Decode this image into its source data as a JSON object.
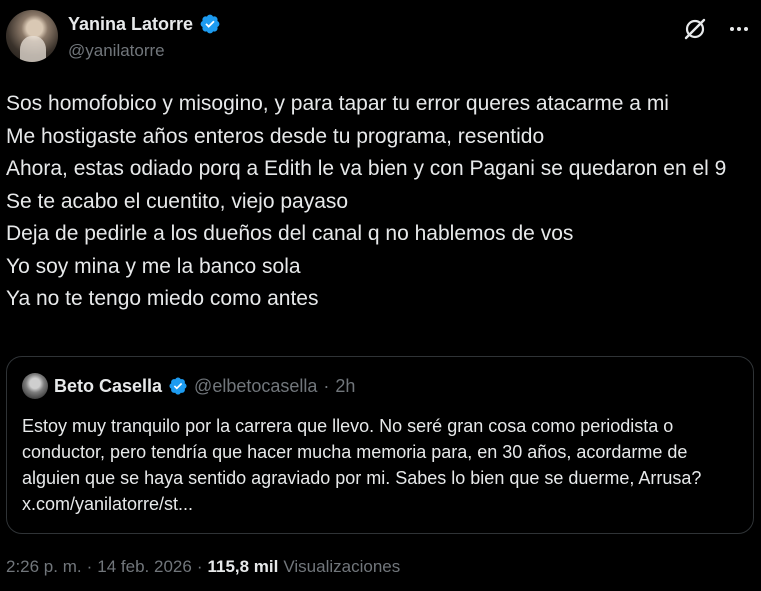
{
  "author": {
    "name": "Yanina Latorre",
    "handle": "@yanilatorre",
    "verified": true
  },
  "tweet": {
    "text": "Sos homofobico y misogino, y para tapar tu error queres atacarme a mi\nMe hostigaste años enteros desde tu programa, resentido\nAhora, estas odiado porq a Edith le va bien y con Pagani se quedaron en el 9\nSe te acabo el cuentito, viejo payaso\nDeja de pedirle a los dueños del canal q no hablemos de vos\nYo soy mina y me la banco sola\nYa no te tengo miedo como antes"
  },
  "quote": {
    "name": "Beto Casella",
    "handle": "@elbetocasella",
    "separator": "·",
    "time": "2h",
    "text": "Estoy muy tranquilo por la carrera que llevo. No seré gran cosa como periodista o conductor, pero tendría que hacer mucha memoria para, en 30 años, acordarme de alguien que se haya sentido agraviado por mi. Sabes lo bien que se duerme, Arrusa? x.com/yanilatorre/st..."
  },
  "meta": {
    "time": "2:26 p. m.",
    "sep1": "·",
    "date": "14 feb. 2026",
    "sep2": "·",
    "views_count": "115,8 mil",
    "views_label": "Visualizaciones"
  },
  "icons": {
    "verified": "verified-badge-icon",
    "grok": "grok-icon",
    "more": "more-options-icon"
  },
  "colors": {
    "background": "#000000",
    "text": "#e7e9ea",
    "secondary": "#71767b",
    "verified": "#1d9bf0",
    "border": "#2f3336"
  }
}
